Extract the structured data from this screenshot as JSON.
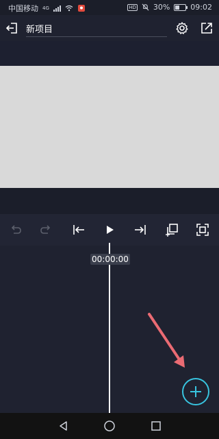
{
  "status_bar": {
    "carrier": "中国移动",
    "network": "4G",
    "hd": "HD",
    "battery_percent": "30%",
    "time": "09:02"
  },
  "header": {
    "project_title": "新项目"
  },
  "preview": {
    "background": "#d9d9d9"
  },
  "toolbar": {
    "items": [
      "undo-icon",
      "redo-icon",
      "skip-to-start-icon",
      "play-icon",
      "skip-to-end-icon",
      "duplicate-icon",
      "fullscreen-icon"
    ]
  },
  "timeline": {
    "time": "00:00:00"
  },
  "fab": {
    "color": "#38c4df"
  },
  "annotation": {
    "arrow_color": "#ea6b73"
  }
}
